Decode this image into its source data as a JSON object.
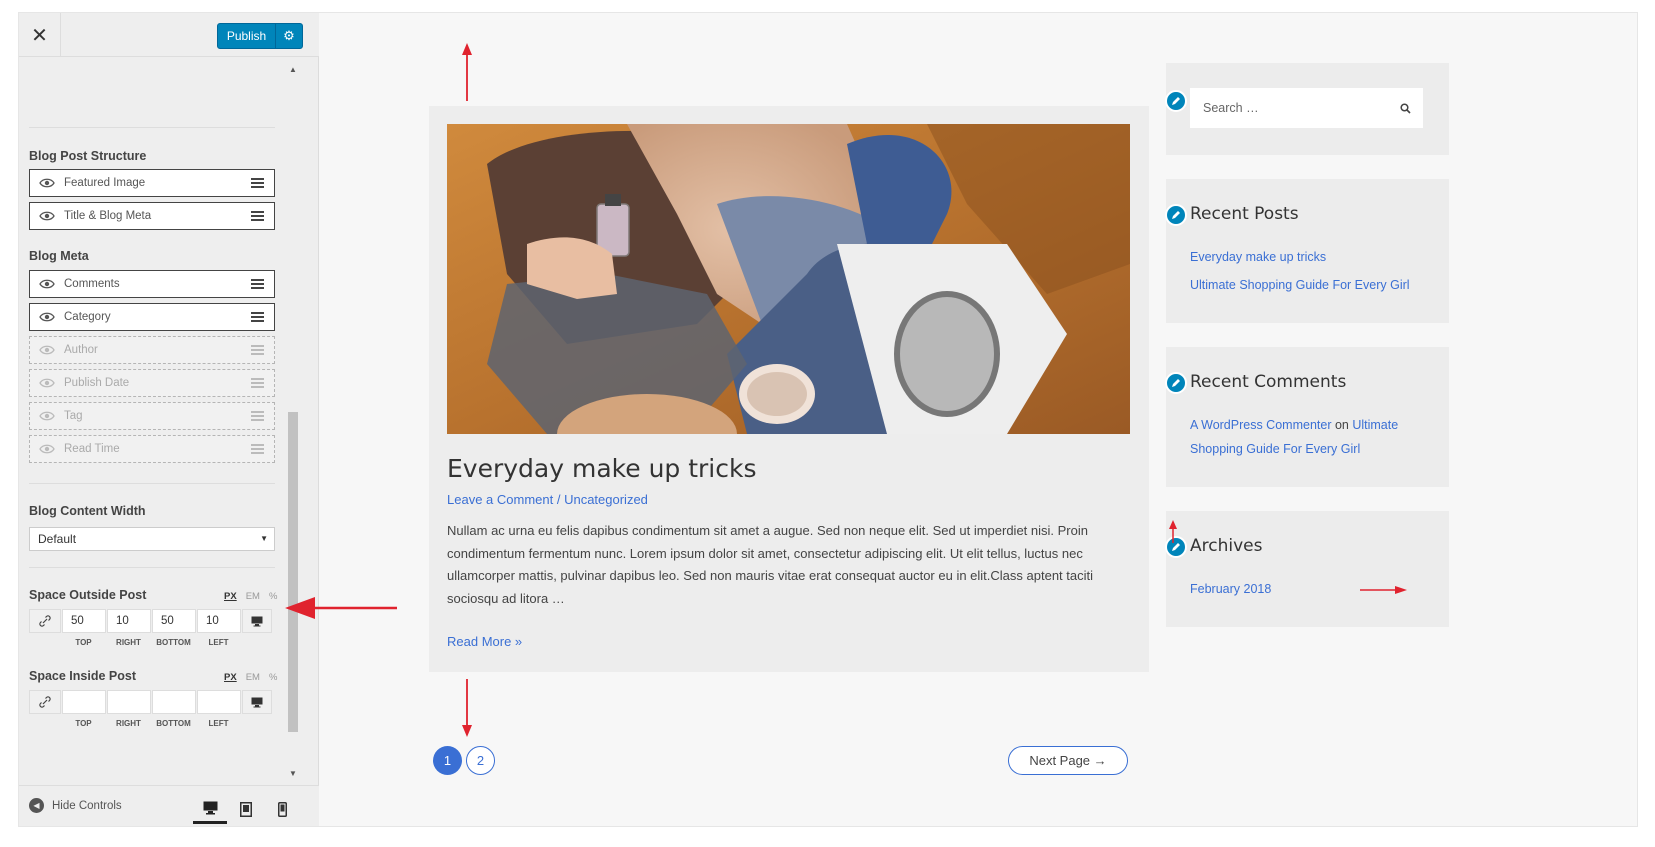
{
  "panel": {
    "close_icon": "close-icon",
    "publish_label": "Publish",
    "publish_gear_icon": "gear-icon",
    "structure_title": "Blog Post Structure",
    "structure_items": [
      "Featured Image",
      "Title & Blog Meta"
    ],
    "meta_title": "Blog Meta",
    "meta_items_enabled": [
      "Comments",
      "Category"
    ],
    "meta_items_disabled": [
      "Author",
      "Publish Date",
      "Tag",
      "Read Time"
    ],
    "content_width_title": "Blog Content Width",
    "content_width_value": "Default",
    "space_outside_title": "Space Outside Post",
    "space_inside_title": "Space Inside Post",
    "units": [
      "PX",
      "EM",
      "%"
    ],
    "outside_values": {
      "top": "50",
      "right": "10",
      "bottom": "50",
      "left": "10"
    },
    "spacing_labels": [
      "TOP",
      "RIGHT",
      "BOTTOM",
      "LEFT"
    ],
    "hide_controls_label": "Hide Controls"
  },
  "article": {
    "title": "Everyday make up tricks",
    "meta_comment": "Leave a Comment",
    "meta_sep": " / ",
    "meta_category": "Uncategorized",
    "excerpt": "Nullam ac urna eu felis dapibus condimentum sit amet a augue. Sed non neque elit. Sed ut imperdiet nisi. Proin condimentum fermentum nunc. Lorem ipsum dolor sit amet, consectetur adipiscing elit. Ut elit tellus, luctus nec ullamcorper mattis, pulvinar dapibus leo. Sed non mauris vitae erat consequat auctor eu in elit.Class aptent taciti sociosqu ad litora …",
    "read_more": "Read More »"
  },
  "pagination": {
    "page1": "1",
    "page2": "2",
    "next": "Next Page →"
  },
  "sidebar": {
    "search_placeholder": "Search …",
    "recent_posts_title": "Recent Posts",
    "recent_posts": [
      "Everyday make up tricks",
      "Ultimate Shopping Guide For Every Girl"
    ],
    "recent_comments_title": "Recent Comments",
    "comment_author": "A WordPress Commenter",
    "comment_on": " on ",
    "comment_post_line1": "Ultimate",
    "comment_post_line2": "Shopping Guide For Every Girl",
    "archives_title": "Archives",
    "archive_item": "February 2018"
  },
  "colors": {
    "accent": "#0085ba",
    "link": "#3a6fd4",
    "annotation": "#e0232e"
  }
}
